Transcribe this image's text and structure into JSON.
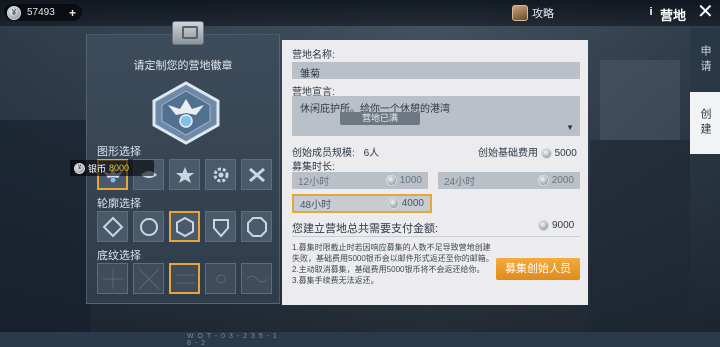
{
  "topbar": {
    "silver_amount": "57493",
    "plus": "+",
    "guide_label": "攻略",
    "info": "i",
    "title": "营地",
    "close": "✕"
  },
  "side_tabs": {
    "apply": "申请",
    "create": "创建"
  },
  "emblem_panel": {
    "title": "请定制您的营地徽章",
    "shape_label": "图形选择",
    "outline_label": "轮廓选择",
    "pattern_label": "底纹选择",
    "price_tip": {
      "currency": "银币",
      "amount": "8000"
    },
    "watermark": "W O T - 0 3 - 2 3 5 - 1 8 - 2"
  },
  "form": {
    "name_label": "营地名称:",
    "name_value": "雏菊",
    "declaration_label": "营地宣言:",
    "declaration_value": "休闲庇护所。给你一个休憩的港湾",
    "declaration_badge": "营地已满",
    "member_size_label": "创始成员规模:",
    "member_size_value": "6人",
    "base_fee_label": "创始基础费用",
    "base_fee_value": "5000",
    "duration_label": "募集时长:",
    "durations": [
      {
        "label": "12小时",
        "price": "1000"
      },
      {
        "label": "24小时",
        "price": "2000"
      },
      {
        "label": "48小时",
        "price": "4000"
      }
    ],
    "total_label": "您建立营地总共需要支付金额:",
    "total_value": "9000",
    "notes": [
      "1.募集时限截止时若因响应募集的人数不足导致营地创建失败，基础费用5000银币会以邮件形式返还至你的邮箱。",
      "2.主动取消募集，基础费用5000银币将不会返还给你。",
      "3.募集手续费无法返还。"
    ],
    "recruit_button": "募集创始人员"
  },
  "colors": {
    "accent": "#e6a63a",
    "button": "#f09a2a",
    "panel": "#ececee"
  }
}
